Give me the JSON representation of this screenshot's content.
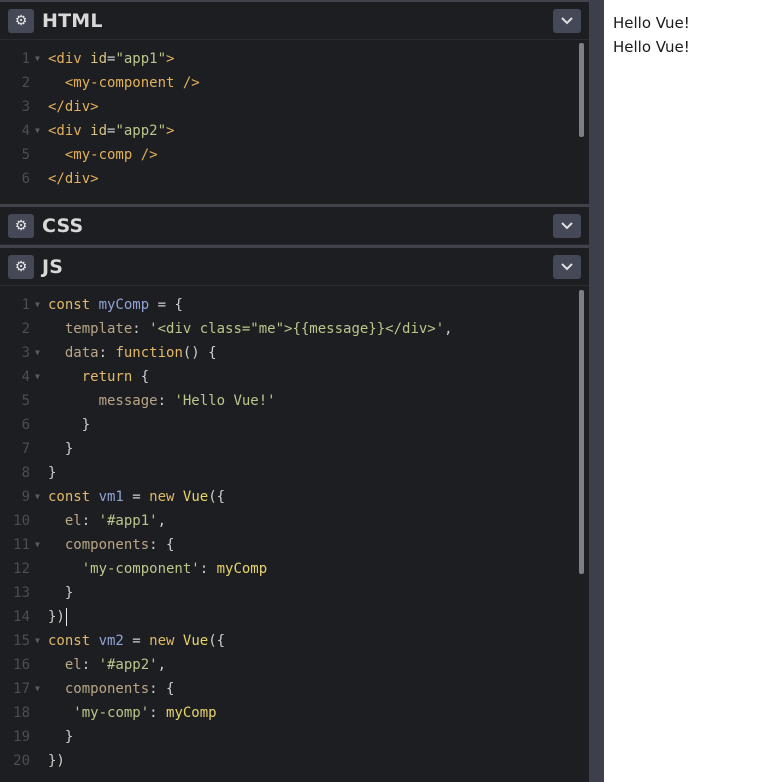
{
  "panes": {
    "html": {
      "title": "HTML"
    },
    "css": {
      "title": "CSS"
    },
    "js": {
      "title": "JS"
    }
  },
  "html_code": [
    {
      "n": "1",
      "fold": true,
      "segs": [
        [
          "tag",
          "<div "
        ],
        [
          "attr",
          "id"
        ],
        [
          "plain",
          "="
        ],
        [
          "str",
          "\"app1\""
        ],
        [
          "tag",
          ">"
        ]
      ]
    },
    {
      "n": "2",
      "fold": false,
      "segs": [
        [
          "plain",
          "  "
        ],
        [
          "tag",
          "<my-component />"
        ]
      ]
    },
    {
      "n": "3",
      "fold": false,
      "segs": [
        [
          "tag",
          "</div>"
        ]
      ]
    },
    {
      "n": "4",
      "fold": true,
      "segs": [
        [
          "tag",
          "<div "
        ],
        [
          "attr",
          "id"
        ],
        [
          "plain",
          "="
        ],
        [
          "str",
          "\"app2\""
        ],
        [
          "tag",
          ">"
        ]
      ]
    },
    {
      "n": "5",
      "fold": false,
      "segs": [
        [
          "plain",
          "  "
        ],
        [
          "tag",
          "<my-comp />"
        ]
      ]
    },
    {
      "n": "6",
      "fold": false,
      "segs": [
        [
          "tag",
          "</div>"
        ]
      ]
    }
  ],
  "js_code": [
    {
      "n": "1",
      "fold": true,
      "segs": [
        [
          "kw",
          "const "
        ],
        [
          "var",
          "myComp"
        ],
        [
          "plain",
          " = {"
        ]
      ]
    },
    {
      "n": "2",
      "fold": false,
      "segs": [
        [
          "plain",
          "  "
        ],
        [
          "prop",
          "template"
        ],
        [
          "plain",
          ": "
        ],
        [
          "str",
          "'<div class=\"me\">{{message}}</div>'"
        ],
        [
          "plain",
          ","
        ]
      ]
    },
    {
      "n": "3",
      "fold": true,
      "segs": [
        [
          "plain",
          "  "
        ],
        [
          "prop",
          "data"
        ],
        [
          "plain",
          ": "
        ],
        [
          "kw",
          "function"
        ],
        [
          "plain",
          "() {"
        ]
      ]
    },
    {
      "n": "4",
      "fold": true,
      "segs": [
        [
          "plain",
          "    "
        ],
        [
          "kw",
          "return"
        ],
        [
          "plain",
          " {"
        ]
      ]
    },
    {
      "n": "5",
      "fold": false,
      "segs": [
        [
          "plain",
          "      "
        ],
        [
          "prop",
          "message"
        ],
        [
          "plain",
          ": "
        ],
        [
          "str",
          "'Hello Vue!'"
        ]
      ]
    },
    {
      "n": "6",
      "fold": false,
      "segs": [
        [
          "plain",
          "    }"
        ]
      ]
    },
    {
      "n": "7",
      "fold": false,
      "segs": [
        [
          "plain",
          "  }"
        ]
      ]
    },
    {
      "n": "8",
      "fold": false,
      "segs": [
        [
          "plain",
          "}"
        ]
      ]
    },
    {
      "n": "9",
      "fold": true,
      "segs": [
        [
          "kw",
          "const "
        ],
        [
          "var",
          "vm1"
        ],
        [
          "plain",
          " = "
        ],
        [
          "kw",
          "new "
        ],
        [
          "fn",
          "Vue"
        ],
        [
          "plain",
          "({"
        ]
      ]
    },
    {
      "n": "10",
      "fold": false,
      "segs": [
        [
          "plain",
          "  "
        ],
        [
          "prop",
          "el"
        ],
        [
          "plain",
          ": "
        ],
        [
          "str",
          "'#app1'"
        ],
        [
          "plain",
          ","
        ]
      ]
    },
    {
      "n": "11",
      "fold": true,
      "segs": [
        [
          "plain",
          "  "
        ],
        [
          "prop",
          "components"
        ],
        [
          "plain",
          ": {"
        ]
      ]
    },
    {
      "n": "12",
      "fold": false,
      "segs": [
        [
          "plain",
          "    "
        ],
        [
          "str",
          "'my-component'"
        ],
        [
          "plain",
          ": "
        ],
        [
          "fn",
          "myComp"
        ]
      ]
    },
    {
      "n": "13",
      "fold": false,
      "segs": [
        [
          "plain",
          "  }"
        ]
      ]
    },
    {
      "n": "14",
      "fold": false,
      "cursor": true,
      "segs": [
        [
          "plain",
          "})"
        ]
      ]
    },
    {
      "n": "15",
      "fold": true,
      "segs": [
        [
          "kw",
          "const "
        ],
        [
          "var",
          "vm2"
        ],
        [
          "plain",
          " = "
        ],
        [
          "kw",
          "new "
        ],
        [
          "fn",
          "Vue"
        ],
        [
          "plain",
          "({"
        ]
      ]
    },
    {
      "n": "16",
      "fold": false,
      "segs": [
        [
          "plain",
          "  "
        ],
        [
          "prop",
          "el"
        ],
        [
          "plain",
          ": "
        ],
        [
          "str",
          "'#app2'"
        ],
        [
          "plain",
          ","
        ]
      ]
    },
    {
      "n": "17",
      "fold": true,
      "segs": [
        [
          "plain",
          "  "
        ],
        [
          "prop",
          "components"
        ],
        [
          "plain",
          ": {"
        ]
      ]
    },
    {
      "n": "18",
      "fold": false,
      "segs": [
        [
          "plain",
          "   "
        ],
        [
          "str",
          "'my-comp'"
        ],
        [
          "plain",
          ": "
        ],
        [
          "fn",
          "myComp"
        ]
      ]
    },
    {
      "n": "19",
      "fold": false,
      "segs": [
        [
          "plain",
          "  }"
        ]
      ]
    },
    {
      "n": "20",
      "fold": false,
      "segs": [
        [
          "plain",
          "})"
        ]
      ]
    }
  ],
  "preview": {
    "lines": [
      "Hello Vue!",
      "Hello Vue!"
    ]
  },
  "icons": {
    "settings": "gear-icon",
    "collapse": "chevron-down-icon"
  },
  "colors": {
    "editor_bg": "#1d1e22",
    "button_bg": "#444857",
    "divider": "#3d3f4a"
  }
}
